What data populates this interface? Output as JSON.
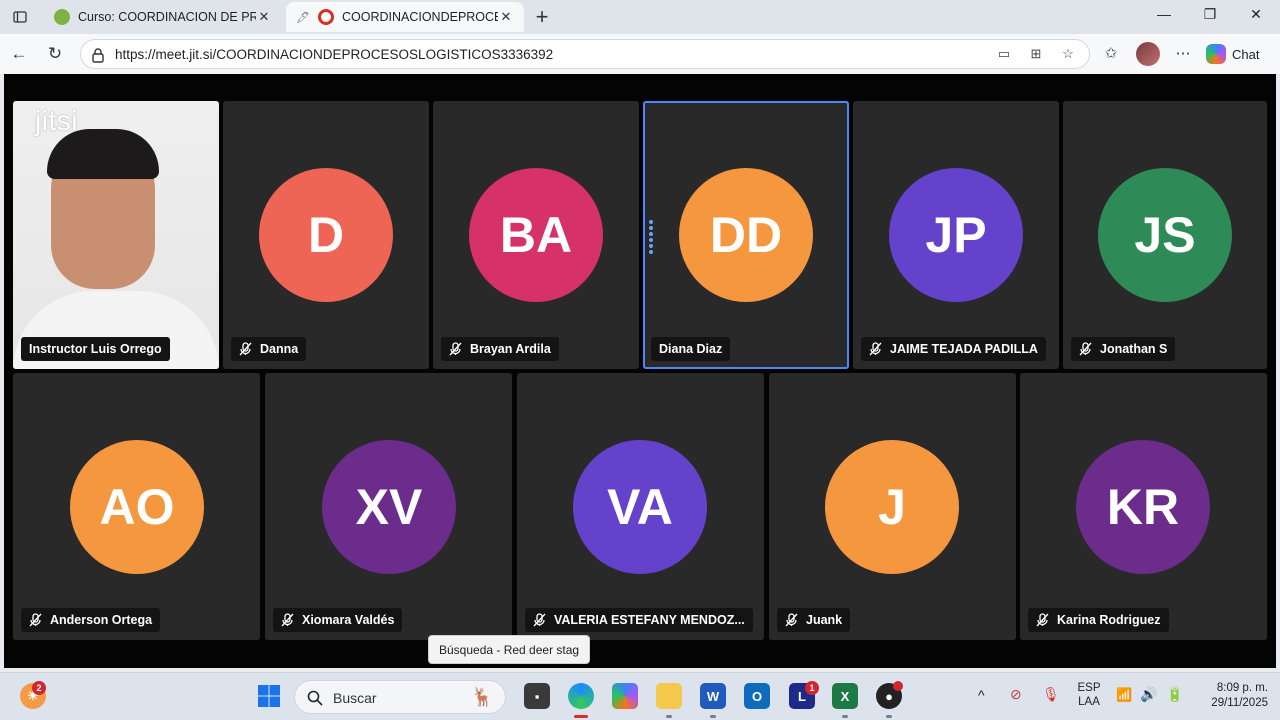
{
  "browser": {
    "tabs": [
      {
        "title": "Curso: COORDINACION DE PROCE",
        "active": false,
        "favicon_color": "#7cb342"
      },
      {
        "title": "COORDINACIONDEPROCES",
        "active": true,
        "favicon_color": "#d93025"
      }
    ],
    "url": "https://meet.jit.si/COORDINACIONDEPROCESOSLOGISTICOS3336392",
    "chat_label": "Chat"
  },
  "meeting": {
    "logo_text": "jitsi",
    "participants": [
      {
        "name": "Instructor Luis Orrego",
        "initials": "",
        "color": "",
        "muted": false,
        "video": true
      },
      {
        "name": "Danna",
        "initials": "D",
        "color": "#ee6555",
        "muted": true
      },
      {
        "name": "Brayan Ardila",
        "initials": "BA",
        "color": "#d63169",
        "muted": true
      },
      {
        "name": "Diana Diaz",
        "initials": "DD",
        "color": "#f5973f",
        "muted": false,
        "active": true
      },
      {
        "name": "JAIME TEJADA PADILLA",
        "initials": "JP",
        "color": "#6442cc",
        "muted": true
      },
      {
        "name": "Jonathan S",
        "initials": "JS",
        "color": "#2e8b57",
        "muted": true
      },
      {
        "name": "Anderson Ortega",
        "initials": "AO",
        "color": "#f5973f",
        "muted": true
      },
      {
        "name": "Xiomara Valdés",
        "initials": "XV",
        "color": "#6b2c8c",
        "muted": true
      },
      {
        "name": "VALERIA ESTEFANY MENDOZ...",
        "initials": "VA",
        "color": "#6442cc",
        "muted": true
      },
      {
        "name": "Juank",
        "initials": "J",
        "color": "#f5973f",
        "muted": true
      },
      {
        "name": "Karina Rodriguez",
        "initials": "KR",
        "color": "#6b2c8c",
        "muted": true
      }
    ]
  },
  "tooltip": "Búsqueda - Red deer stag",
  "taskbar": {
    "search_label": "Buscar",
    "widgets_badge": "2",
    "lexmark_badge": "1",
    "language": "ESP",
    "layout": "LAA",
    "time": "8:09 p. m.",
    "date": "29/11/2025"
  }
}
